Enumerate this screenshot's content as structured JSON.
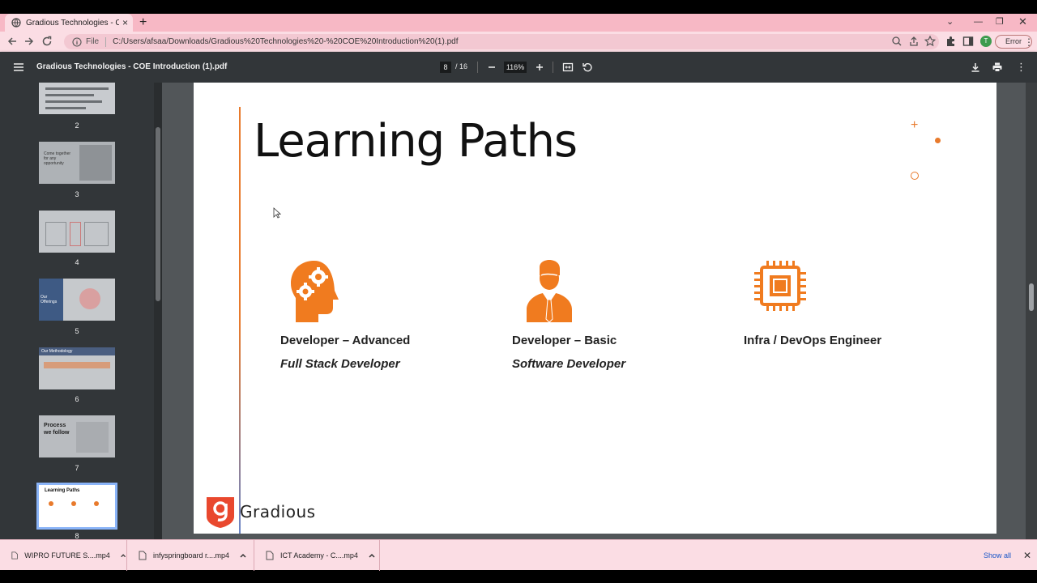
{
  "browser": {
    "tab_title": "Gradious Technologies - COE Int",
    "address_scheme": "File",
    "url": "C:/Users/afsaa/Downloads/Gradious%20Technologies%20-%20COE%20Introduction%20(1).pdf",
    "profile_initial": "T",
    "error_label": "Error"
  },
  "pdf": {
    "title": "Gradious Technologies - COE Introduction (1).pdf",
    "current_page": "8",
    "total_pages": "/ 16",
    "zoom": "116%"
  },
  "thumbnails": [
    {
      "label": "2",
      "heading": ""
    },
    {
      "label": "3",
      "heading": "Come together for any opportunity"
    },
    {
      "label": "4",
      "heading": ""
    },
    {
      "label": "5",
      "heading": "Our Offerings"
    },
    {
      "label": "6",
      "heading": "Our Methodology"
    },
    {
      "label": "7",
      "heading": "Process we follow"
    },
    {
      "label": "8",
      "heading": "Learning Paths",
      "selected": true
    }
  ],
  "slide": {
    "title": "Learning Paths",
    "paths": [
      {
        "name": "Developer – Advanced",
        "role": "Full Stack Developer",
        "icon": "head-gears-icon"
      },
      {
        "name": "Developer – Basic",
        "role": "Software Developer",
        "icon": "person-tie-icon"
      },
      {
        "name": "Infra / DevOps Engineer",
        "role": "",
        "icon": "chip-icon"
      }
    ],
    "brand": "Gradious",
    "brand_mark": "g",
    "accent_color": "#e87a2c"
  },
  "downloads": {
    "items": [
      {
        "name": "WIPRO FUTURE S....mp4"
      },
      {
        "name": "infyspringboard r....mp4"
      },
      {
        "name": "ICT Academy - C....mp4"
      }
    ],
    "show_all": "Show all"
  }
}
